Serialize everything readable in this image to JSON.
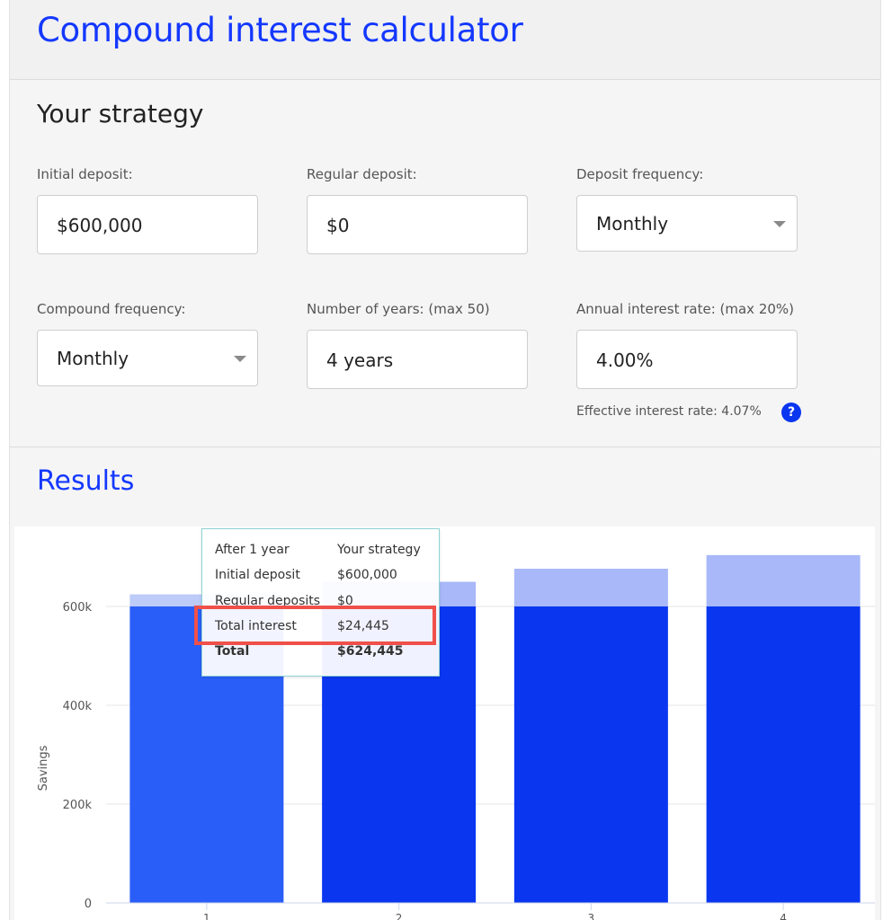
{
  "header": {
    "title": "Compound interest calculator"
  },
  "strategy": {
    "title": "Your strategy",
    "initial_deposit": {
      "label": "Initial deposit:",
      "value": "$600,000"
    },
    "regular_deposit": {
      "label": "Regular deposit:",
      "value": "$0"
    },
    "deposit_frequency": {
      "label": "Deposit frequency:",
      "value": "Monthly"
    },
    "compound_frequency": {
      "label": "Compound frequency:",
      "value": "Monthly"
    },
    "years": {
      "label": "Number of years: (max 50)",
      "value": "4 years"
    },
    "interest_rate": {
      "label": "Annual interest rate: (max 20%)",
      "value": "4.00%"
    },
    "effective_rate": "Effective interest rate: 4.07%",
    "help_icon": {
      "name": "question-mark-icon",
      "glyph": "?"
    }
  },
  "results": {
    "title": "Results"
  },
  "tooltip": {
    "heading_left": "After 1 year",
    "heading_right": "Your strategy",
    "rows": [
      {
        "label": "Initial deposit",
        "value": "$600,000"
      },
      {
        "label": "Regular deposits",
        "value": "$0"
      },
      {
        "label": "Total interest",
        "value": "$24,445"
      }
    ],
    "total": {
      "label": "Total",
      "value": "$624,445"
    }
  },
  "colors": {
    "accent": "#1438ff",
    "bar_principal": "#0a36f0",
    "bar_principal_hover": "#2a5ef8",
    "bar_interest": "#a8b8f8",
    "bar_interest_hover": "#bccbf8",
    "highlight": "#f0504a"
  },
  "chart_data": {
    "type": "bar",
    "stacked": true,
    "categories": [
      "1",
      "2",
      "3",
      "4"
    ],
    "ylabel": "Savings",
    "yticks": [
      "0",
      "200k",
      "400k",
      "600k"
    ],
    "ylim": [
      0,
      740000
    ],
    "grid": true,
    "highlighted_category": "1",
    "series": [
      {
        "values": [
          600000,
          600000,
          600000,
          600000
        ]
      },
      {
        "values": [
          24445,
          49885,
          76361,
          103916
        ]
      }
    ]
  }
}
